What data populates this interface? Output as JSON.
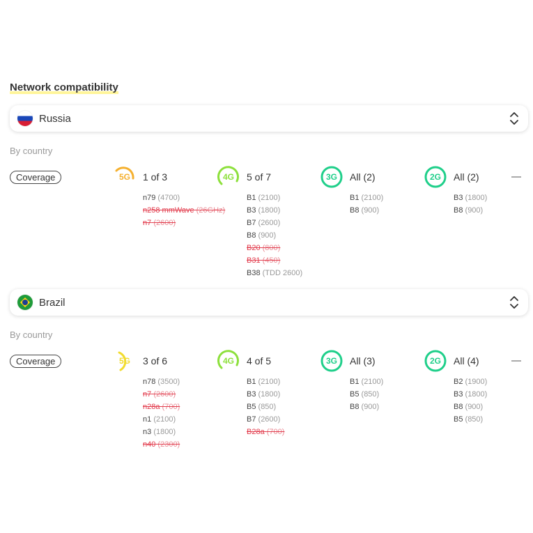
{
  "section_title": "Network compatibility",
  "colors": {
    "g5_orange": "#f5b02e",
    "g5_yellow": "#f2dc2e",
    "g4": "#8de03c",
    "g3": "#1fcf8a",
    "g2": "#1fcf8a",
    "strike": "#e23a4b"
  },
  "countries": [
    {
      "name": "Russia",
      "flag_icon": "russia-flag-icon",
      "by_country_label": "By country",
      "coverage_label": "Coverage",
      "networks": {
        "g5": {
          "label": "5G",
          "summary": "1 of 3",
          "bands": [
            {
              "name": "n79",
              "freq": "(4700)",
              "ok": true
            },
            {
              "name": "n258 mmWave",
              "freq": "(26GHz)",
              "ok": false
            },
            {
              "name": "n7",
              "freq": "(2600)",
              "ok": false
            }
          ]
        },
        "g4": {
          "label": "4G",
          "summary": "5 of 7",
          "bands": [
            {
              "name": "B1",
              "freq": "(2100)",
              "ok": true
            },
            {
              "name": "B3",
              "freq": "(1800)",
              "ok": true
            },
            {
              "name": "B7",
              "freq": "(2600)",
              "ok": true
            },
            {
              "name": "B8",
              "freq": "(900)",
              "ok": true
            },
            {
              "name": "B20",
              "freq": "(800)",
              "ok": false
            },
            {
              "name": "B31",
              "freq": "(450)",
              "ok": false
            },
            {
              "name": "B38",
              "freq": "(TDD 2600)",
              "ok": true
            }
          ]
        },
        "g3": {
          "label": "3G",
          "summary": "All (2)",
          "bands": [
            {
              "name": "B1",
              "freq": "(2100)",
              "ok": true
            },
            {
              "name": "B8",
              "freq": "(900)",
              "ok": true
            }
          ]
        },
        "g2": {
          "label": "2G",
          "summary": "All (2)",
          "bands": [
            {
              "name": "B3",
              "freq": "(1800)",
              "ok": true
            },
            {
              "name": "B8",
              "freq": "(900)",
              "ok": true
            }
          ]
        }
      }
    },
    {
      "name": "Brazil",
      "flag_icon": "brazil-flag-icon",
      "by_country_label": "By country",
      "coverage_label": "Coverage",
      "networks": {
        "g5": {
          "label": "5G",
          "summary": "3 of 6",
          "bands": [
            {
              "name": "n78",
              "freq": "(3500)",
              "ok": true
            },
            {
              "name": "n7",
              "freq": "(2600)",
              "ok": false
            },
            {
              "name": "n28a",
              "freq": "(700)",
              "ok": false
            },
            {
              "name": "n1",
              "freq": "(2100)",
              "ok": true
            },
            {
              "name": "n3",
              "freq": "(1800)",
              "ok": true
            },
            {
              "name": "n40",
              "freq": "(2300)",
              "ok": false
            }
          ]
        },
        "g4": {
          "label": "4G",
          "summary": "4 of 5",
          "bands": [
            {
              "name": "B1",
              "freq": "(2100)",
              "ok": true
            },
            {
              "name": "B3",
              "freq": "(1800)",
              "ok": true
            },
            {
              "name": "B5",
              "freq": "(850)",
              "ok": true
            },
            {
              "name": "B7",
              "freq": "(2600)",
              "ok": true
            },
            {
              "name": "B28a",
              "freq": "(700)",
              "ok": false
            }
          ]
        },
        "g3": {
          "label": "3G",
          "summary": "All (3)",
          "bands": [
            {
              "name": "B1",
              "freq": "(2100)",
              "ok": true
            },
            {
              "name": "B5",
              "freq": "(850)",
              "ok": true
            },
            {
              "name": "B8",
              "freq": "(900)",
              "ok": true
            }
          ]
        },
        "g2": {
          "label": "2G",
          "summary": "All (4)",
          "bands": [
            {
              "name": "B2",
              "freq": "(1900)",
              "ok": true
            },
            {
              "name": "B3",
              "freq": "(1800)",
              "ok": true
            },
            {
              "name": "B8",
              "freq": "(900)",
              "ok": true
            },
            {
              "name": "B5",
              "freq": "(850)",
              "ok": true
            }
          ]
        }
      }
    }
  ]
}
